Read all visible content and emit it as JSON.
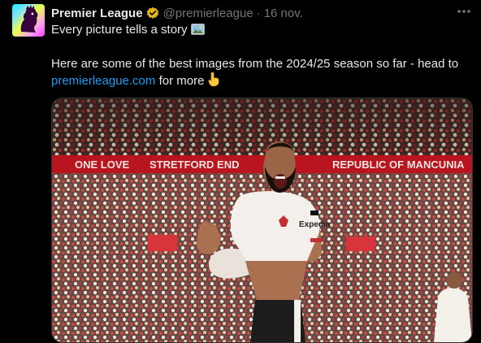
{
  "account": {
    "name": "Premier League",
    "handle": "@premierleague",
    "separator": "·",
    "time": "16 nov."
  },
  "tweet": {
    "line1": "Every picture tells a story",
    "line2": "Here are some of the best images from the 2024/25 season so far - head to",
    "link": "premierleague.com",
    "line3_suffix": "for more"
  },
  "media": {
    "banner_left": "ONE LOVE",
    "banner_mid": "STRETFORD END",
    "banner_right": "REPUBLIC OF MANCUNIA",
    "shirt_sponsor": "Expedia"
  },
  "colors": {
    "accent_link": "#1d9bf0",
    "verified_badge": "#e2b719",
    "secondary_text": "#71767b"
  },
  "icons": [
    "premier-league-lion-icon",
    "verified-badge-icon",
    "more-options-icon",
    "picture-emoji-icon",
    "pointing-down-emoji-icon"
  ]
}
